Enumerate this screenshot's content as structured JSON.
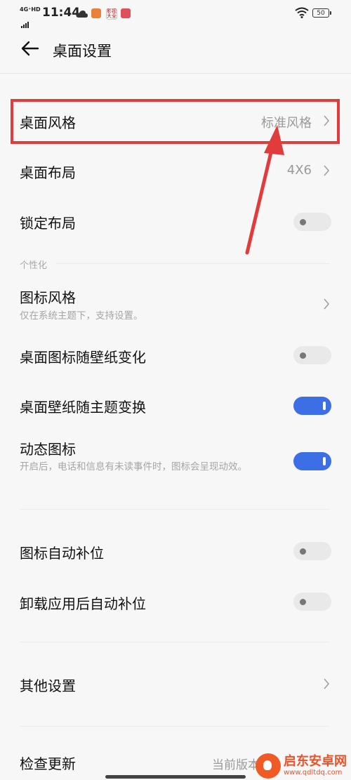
{
  "status_bar": {
    "network": "4G⁺HD",
    "time": "11:44",
    "app_badge_text": "影视大全",
    "battery": "50"
  },
  "header": {
    "title": "桌面设置"
  },
  "settings": {
    "desktop_style": {
      "label": "桌面风格",
      "value": "标准风格"
    },
    "desktop_layout": {
      "label": "桌面布局",
      "value": "4X6"
    },
    "lock_layout": {
      "label": "锁定布局",
      "toggle": false
    }
  },
  "personalization": {
    "section_title": "个性化",
    "icon_style": {
      "label": "图标风格",
      "subtitle": "仅在系统主题下，支持设置。"
    },
    "icon_follow_wallpaper": {
      "label": "桌面图标随壁纸变化",
      "toggle": false
    },
    "wallpaper_follow_theme": {
      "label": "桌面壁纸随主题变换",
      "toggle": true
    },
    "dynamic_icons": {
      "label": "动态图标",
      "subtitle": "开启后，电话和信息有未读事件时，图标会呈现动效。",
      "toggle": true
    }
  },
  "auto_fill": {
    "icon_auto_fill": {
      "label": "图标自动补位",
      "toggle": false
    },
    "uninstall_auto_fill": {
      "label": "卸载应用后自动补位",
      "toggle": false
    }
  },
  "other": {
    "label": "其他设置"
  },
  "update": {
    "label": "检查更新",
    "value": "当前版本"
  },
  "watermark": {
    "name": "启东安卓网",
    "url": "www.qdltdq.com"
  },
  "colors": {
    "accent": "#3c6fe6",
    "highlight": "#e23b3b"
  }
}
